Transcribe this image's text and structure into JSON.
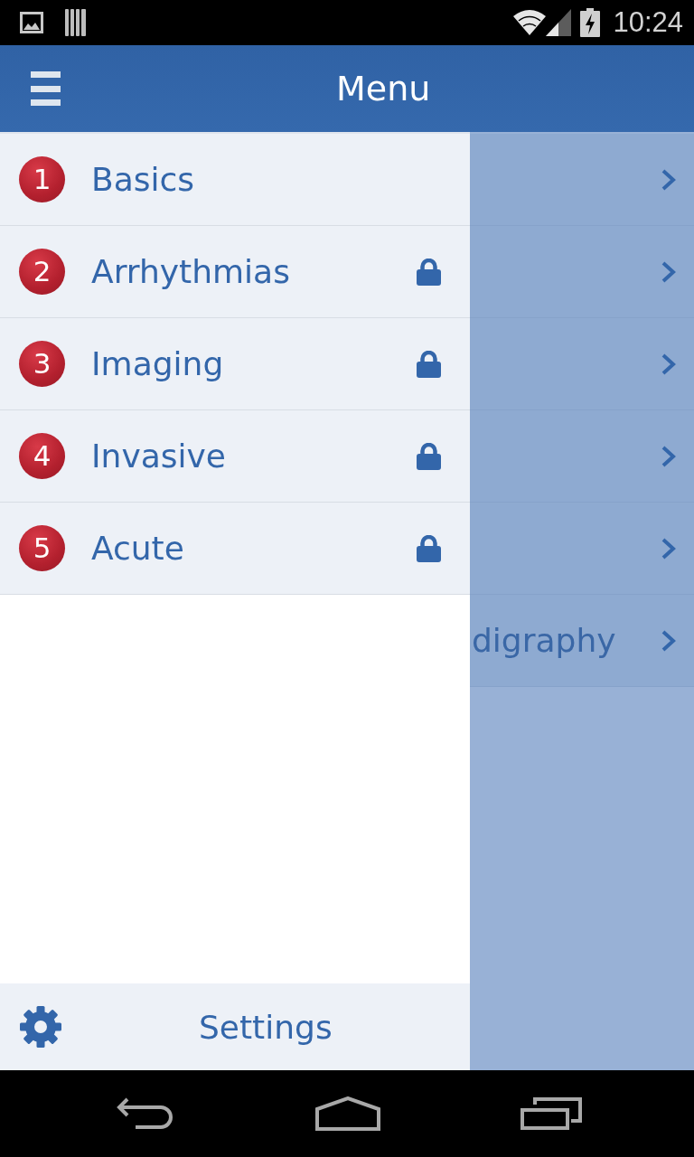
{
  "status_bar": {
    "time": "10:24"
  },
  "app_bar": {
    "title": "Menu"
  },
  "drawer": {
    "items": [
      {
        "number": "1",
        "label": "Basics",
        "locked": false
      },
      {
        "number": "2",
        "label": "Arrhythmias",
        "locked": true
      },
      {
        "number": "3",
        "label": "Imaging",
        "locked": true
      },
      {
        "number": "4",
        "label": "Invasive",
        "locked": true
      },
      {
        "number": "5",
        "label": "Acute",
        "locked": true
      }
    ],
    "settings_button": {
      "label": "Settings"
    }
  },
  "background_list": {
    "rows": [
      {
        "kind": "covered"
      },
      {
        "kind": "covered"
      },
      {
        "kind": "covered"
      },
      {
        "kind": "covered"
      },
      {
        "kind": "covered"
      },
      {
        "kind": "titled",
        "label": "digraphy"
      }
    ]
  }
}
